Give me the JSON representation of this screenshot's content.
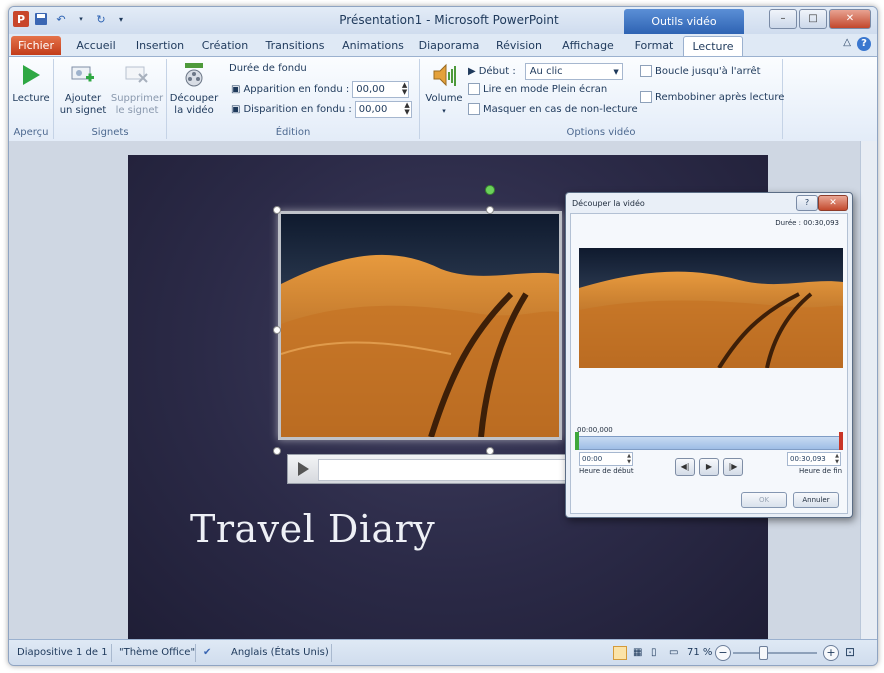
{
  "window": {
    "title": "Présentation1 - Microsoft PowerPoint",
    "contextual_tab": "Outils vidéo",
    "app_icon": "P"
  },
  "tabs": [
    "Fichier",
    "Accueil",
    "Insertion",
    "Création",
    "Transitions",
    "Animations",
    "Diaporama",
    "Révision",
    "Affichage",
    "Format",
    "Lecture"
  ],
  "active_tab": "Lecture",
  "ribbon": {
    "apercu": {
      "label": "Aperçu",
      "lecture_button": "Lecture"
    },
    "signets": {
      "label": "Signets",
      "add_line1": "Ajouter",
      "add_line2": "un signet",
      "remove_line1": "Supprimer",
      "remove_line2": "le signet"
    },
    "edition": {
      "label": "Édition",
      "trim_line1": "Découper",
      "trim_line2": "la vidéo",
      "fade_title": "Durée de fondu",
      "fade_in_label": "Apparition en fondu :",
      "fade_in_value": "00,00",
      "fade_out_label": "Disparition en fondu :",
      "fade_out_value": "00,00"
    },
    "options": {
      "label": "Options vidéo",
      "volume": "Volume",
      "start_label": "Début :",
      "start_value": "Au clic",
      "fullscreen": "Lire en mode Plein écran",
      "hide": "Masquer en cas de non-lecture",
      "loop": "Boucle jusqu'à l'arrêt",
      "rewind": "Rembobiner après lecture"
    }
  },
  "slide": {
    "title": "Travel Diary"
  },
  "dialog": {
    "title": "Découper la vidéo",
    "duration": "Durée : 00:30,093",
    "current_time": "00:00,000",
    "start_value": "00:00",
    "start_label": "Heure de début",
    "end_value": "00:30,093",
    "end_label": "Heure de fin",
    "ok": "OK",
    "cancel": "Annuler"
  },
  "status": {
    "slide": "Diapositive 1 de 1",
    "theme": "\"Thème Office\"",
    "language": "Anglais (États Unis)",
    "zoom": "71 %"
  },
  "colors": {
    "file_tab": "#c23c1a",
    "contextual": "#2e63b3",
    "slide_bg": "#2b2a47"
  }
}
